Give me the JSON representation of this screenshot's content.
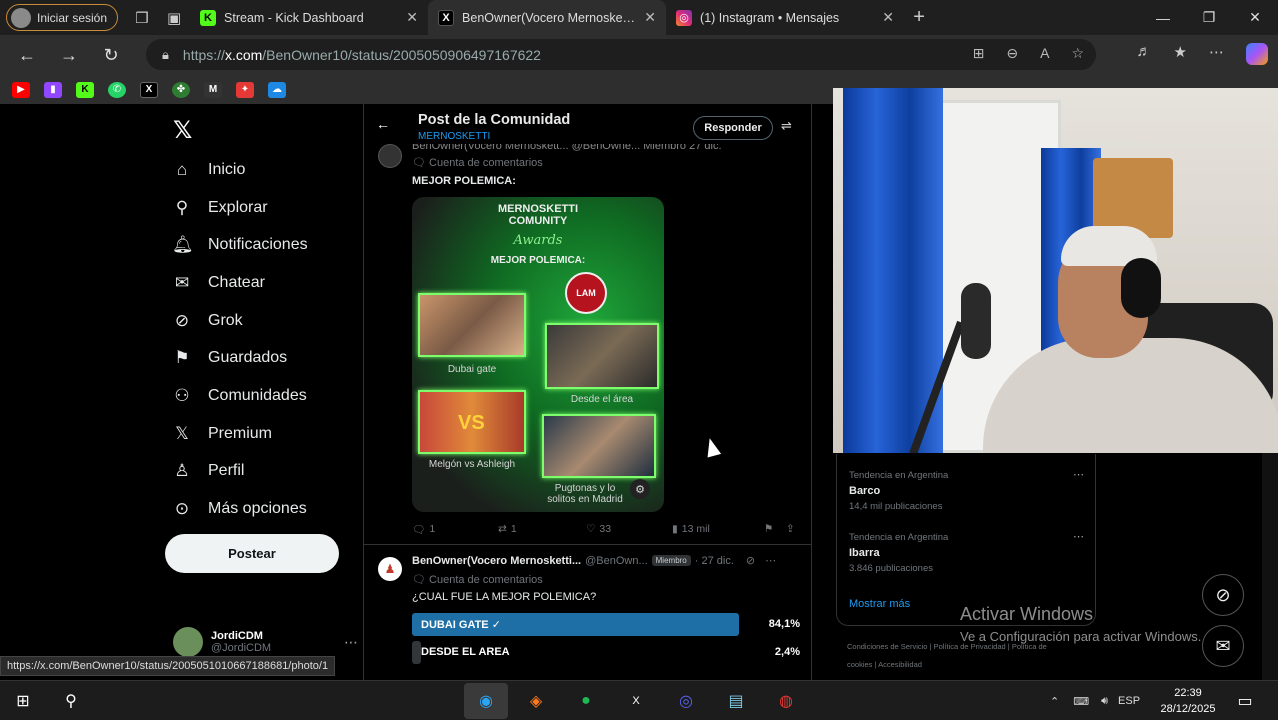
{
  "browser": {
    "signin_label": "Iniciar sesión",
    "tabs": [
      {
        "title": "Stream - Kick Dashboard",
        "favicon": "K",
        "color": "#53fc18"
      },
      {
        "title": "BenOwner(Vocero Mernoskettista",
        "favicon": "X",
        "color": "#000000"
      },
      {
        "title": "(1) Instagram • Mensajes",
        "favicon": "◎",
        "color": "#e1306c"
      }
    ],
    "url_prefix": "https://",
    "url_host": "x.com",
    "url_path": "/BenOwner10/status/2005050906497167622",
    "status_url": "https://x.com/BenOwner10/status/2005051010667188681/photo/1"
  },
  "sidebar": {
    "items": [
      {
        "label": "Inicio",
        "icon": "home-icon",
        "glyph": "⌂"
      },
      {
        "label": "Explorar",
        "icon": "search-icon",
        "glyph": "⚲"
      },
      {
        "label": "Notificaciones",
        "icon": "bell-icon",
        "glyph": "♫"
      },
      {
        "label": "Chatear",
        "icon": "mail-icon",
        "glyph": "✉"
      },
      {
        "label": "Grok",
        "icon": "grok-icon",
        "glyph": "⊘"
      },
      {
        "label": "Guardados",
        "icon": "bookmark-icon",
        "glyph": "⚑"
      },
      {
        "label": "Comunidades",
        "icon": "communities-icon",
        "glyph": "⚇"
      },
      {
        "label": "Premium",
        "icon": "x-premium-icon",
        "glyph": "𝕏"
      },
      {
        "label": "Perfil",
        "icon": "profile-icon",
        "glyph": "♙"
      },
      {
        "label": "Más opciones",
        "icon": "more-icon",
        "glyph": "⊙"
      }
    ],
    "post_button": "Postear",
    "account_name": "JordiCDM",
    "account_handle": "@JordiCDM"
  },
  "header": {
    "title": "Post de la Comunidad",
    "community": "MERNOSKETTI",
    "reply_button": "Responder"
  },
  "tweet1": {
    "cut_header": "BenOwner(Vocero Mernoskett... @BenOwne... Miembro 27 dic.",
    "comment_label": "Cuenta de comentarios",
    "text": "MEJOR POLEMICA:",
    "image": {
      "title_line1": "MERNOSKETTI",
      "title_line2": "COMUNITY",
      "script": "Awards",
      "subtitle": "MEJOR POLEMICA:",
      "lam": "LAM",
      "cap1": "Dubai gate",
      "cap2": "Desde el área",
      "cap3": "Melgón vs Ashleigh",
      "cap4": "Pugtonas y lo solitos en Madrid"
    },
    "stats": {
      "replies": "1",
      "reposts": "1",
      "likes": "33",
      "views": "13 mil"
    }
  },
  "tweet2": {
    "name": "BenOwner(Vocero Mernosketti...",
    "handle": "@BenOwn...",
    "badge": "Miembro",
    "date": "· 27 dic.",
    "comment_label": "Cuenta de comentarios",
    "question": "¿CUAL FUE LA MEJOR POLEMICA?",
    "poll": [
      {
        "label": "DUBAI GATE",
        "pct": "84,1%",
        "value": 84.1,
        "winner": true
      },
      {
        "label": "DESDE EL AREA",
        "pct": "2,4%",
        "value": 2.4,
        "winner": false
      }
    ]
  },
  "trends": [
    {
      "context": "Tendencia en Argentina",
      "name": "Barco",
      "count": "14,4 mil publicaciones"
    },
    {
      "context": "Tendencia en Argentina",
      "name": "Ibarra",
      "count": "3.846 publicaciones"
    }
  ],
  "show_more": "Mostrar más",
  "footer_links": "Condiciones de Servicio | Política de Privacidad | Política de cookies | Accesibilidad",
  "activate": {
    "line1": "Activar Windows",
    "line2": "Ve a Configuración para activar Windows."
  },
  "taskbar": {
    "lang": "ESP",
    "time": "22:39",
    "date": "28/12/2025"
  },
  "colors": {
    "accent": "#1d9bf0",
    "poll_winner": "#1d6fa5",
    "kick_green": "#53fc18"
  }
}
